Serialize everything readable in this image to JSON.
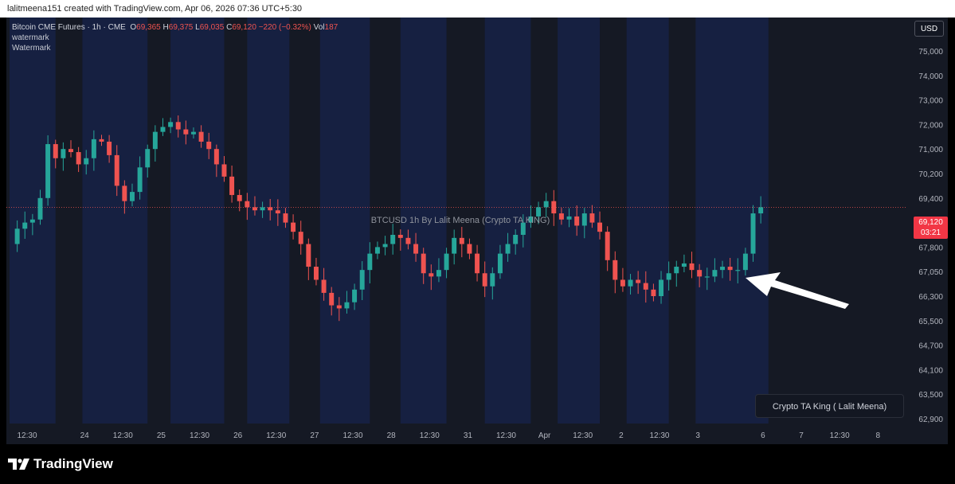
{
  "attribution": "lalitmeena151 created with TradingView.com, Apr 06, 2026 07:36 UTC+5:30",
  "legend": {
    "symbol": "Bitcoin CME Futures · 1h · CME",
    "open_label": "O",
    "open": "69,365",
    "high_label": "H",
    "high": "69,375",
    "low_label": "L",
    "low": "69,035",
    "close_label": "C",
    "close": "69,120",
    "change": "−220 (−0.32%)",
    "vol_label": "Vol",
    "vol": "187",
    "line2": "watermark",
    "line3": "Watermark"
  },
  "currency_button": "USD",
  "center_watermark": "BTCUSD 1h   By Lalit Meena (Crypto TA KING)",
  "name_box": "Crypto TA King ( Lalit Meena)",
  "last_price": "69,120",
  "countdown": "03:21",
  "brand": "TradingView",
  "colors": {
    "up": "#26a69a",
    "down": "#ef5350",
    "session_bg": "#162041",
    "background": "#151924",
    "arrow": "#ffffff"
  },
  "chart_data": {
    "type": "candlestick",
    "price_ticks": [
      "75,000",
      "74,000",
      "73,000",
      "72,000",
      "71,000",
      "70,200",
      "69,400",
      "68,600",
      "67,800",
      "67,050",
      "66,300",
      "65,500",
      "64,700",
      "64,100",
      "63,500",
      "62,900"
    ],
    "price_tick_values": [
      75000,
      74000,
      73000,
      72000,
      71000,
      70200,
      69400,
      68600,
      67800,
      67050,
      66300,
      65500,
      64700,
      64100,
      63500,
      62900
    ],
    "time_labels": [
      "12:30",
      "24",
      "12:30",
      "25",
      "12:30",
      "26",
      "12:30",
      "27",
      "12:30",
      "28",
      "12:30",
      "31",
      "12:30",
      "Apr",
      "12:30",
      "2",
      "12:30",
      "3",
      "6",
      "7",
      "12:30",
      "8"
    ],
    "time_label_pos": [
      0,
      7.5,
      12.5,
      17.5,
      22.5,
      27.5,
      32.5,
      37.5,
      42.5,
      47.5,
      52.5,
      57.5,
      62.5,
      67.5,
      72.5,
      77.5,
      82.5,
      87.5,
      96,
      101,
      106,
      111
    ],
    "close_path": [
      [
        0,
        67.9
      ],
      [
        1,
        68.4
      ],
      [
        2,
        68.6
      ],
      [
        3,
        68.7
      ],
      [
        4,
        69.4
      ],
      [
        5,
        71.2
      ],
      [
        6,
        70.7
      ],
      [
        7,
        71.0
      ],
      [
        8,
        70.9
      ],
      [
        9,
        70.5
      ],
      [
        10,
        70.7
      ],
      [
        11,
        71.4
      ],
      [
        12,
        71.3
      ],
      [
        13,
        70.8
      ],
      [
        14,
        69.8
      ],
      [
        15,
        69.3
      ],
      [
        16,
        69.6
      ],
      [
        17,
        70.4
      ],
      [
        18,
        71.0
      ],
      [
        19,
        71.7
      ],
      [
        20,
        71.9
      ],
      [
        21,
        72.1
      ],
      [
        22,
        71.8
      ],
      [
        23,
        71.6
      ],
      [
        24,
        71.7
      ],
      [
        25,
        71.3
      ],
      [
        26,
        71.0
      ],
      [
        27,
        70.5
      ],
      [
        28,
        70.1
      ],
      [
        29,
        69.5
      ],
      [
        30,
        69.3
      ],
      [
        31,
        69.1
      ],
      [
        32,
        69.0
      ],
      [
        33,
        69.1
      ],
      [
        34,
        69.0
      ],
      [
        35,
        68.9
      ],
      [
        36,
        68.6
      ],
      [
        37,
        68.3
      ],
      [
        38,
        67.9
      ],
      [
        39,
        67.2
      ],
      [
        40,
        66.8
      ],
      [
        41,
        66.4
      ],
      [
        42,
        66.0
      ],
      [
        43,
        65.9
      ],
      [
        44,
        66.1
      ],
      [
        45,
        66.5
      ],
      [
        46,
        67.1
      ],
      [
        47,
        67.6
      ],
      [
        48,
        67.8
      ],
      [
        49,
        67.9
      ],
      [
        50,
        68.2
      ],
      [
        51,
        68.1
      ],
      [
        52,
        67.9
      ],
      [
        53,
        67.6
      ],
      [
        54,
        67.0
      ],
      [
        55,
        66.9
      ],
      [
        56,
        67.1
      ],
      [
        57,
        67.6
      ],
      [
        58,
        68.1
      ],
      [
        59,
        67.9
      ],
      [
        60,
        67.6
      ],
      [
        61,
        67.0
      ],
      [
        62,
        66.6
      ],
      [
        63,
        67.0
      ],
      [
        64,
        67.6
      ],
      [
        65,
        67.9
      ],
      [
        66,
        68.2
      ],
      [
        67,
        68.6
      ],
      [
        68,
        68.8
      ],
      [
        69,
        69.1
      ],
      [
        70,
        69.3
      ],
      [
        71,
        68.9
      ],
      [
        72,
        68.7
      ],
      [
        73,
        68.8
      ],
      [
        74,
        68.5
      ],
      [
        75,
        68.9
      ],
      [
        76,
        68.6
      ],
      [
        77,
        68.3
      ],
      [
        78,
        67.4
      ],
      [
        79,
        66.8
      ],
      [
        80,
        66.6
      ],
      [
        81,
        66.8
      ],
      [
        82,
        66.7
      ],
      [
        83,
        66.5
      ],
      [
        84,
        66.3
      ],
      [
        85,
        66.8
      ],
      [
        86,
        67.0
      ],
      [
        87,
        67.2
      ],
      [
        88,
        67.3
      ],
      [
        89,
        67.1
      ],
      [
        90,
        66.9
      ],
      [
        91,
        66.9
      ],
      [
        92,
        67.1
      ],
      [
        93,
        67.2
      ],
      [
        94,
        67.1
      ],
      [
        95,
        67.1
      ],
      [
        96,
        67.6
      ],
      [
        97,
        68.9
      ],
      [
        98,
        69.1
      ]
    ],
    "ylim": [
      62900,
      75500
    ],
    "xlim": [
      0,
      117
    ],
    "last_bar_index": 98,
    "annotation": "white arrow pointing left at the final breakout candles"
  }
}
